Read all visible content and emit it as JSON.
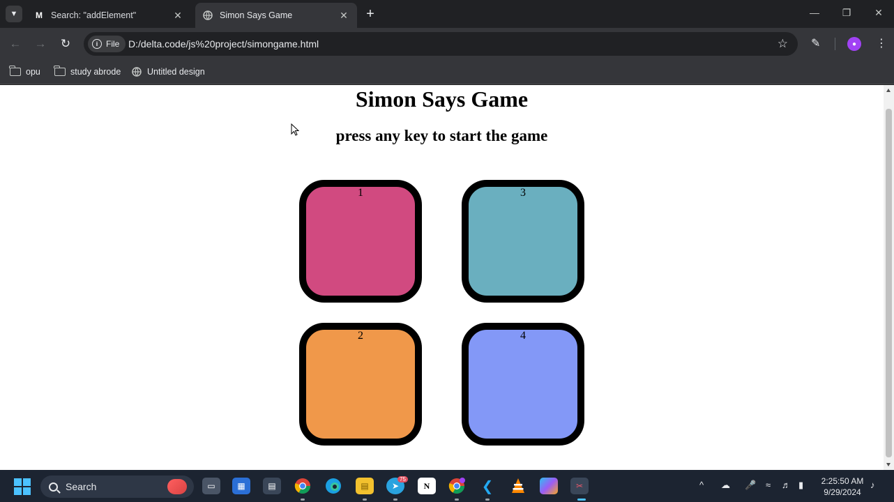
{
  "browser": {
    "tabs": [
      {
        "title": "Search: \"addElement\"",
        "favicon": "M",
        "active": false
      },
      {
        "title": "Simon Says Game",
        "favicon": "globe",
        "active": true
      }
    ],
    "url_scheme": "File",
    "url": "D:/delta.code/js%20project/simongame.html",
    "bookmarks": [
      {
        "label": "opu",
        "icon": "folder-icon"
      },
      {
        "label": "study abrode",
        "icon": "folder-icon"
      },
      {
        "label": "Untitled design",
        "icon": "globe-icon"
      }
    ]
  },
  "page": {
    "title": "Simon Says Game",
    "subtitle": "press any key to start the game",
    "buttons": [
      {
        "label": "1",
        "color": "#d14a80"
      },
      {
        "label": "3",
        "color": "#6aafbf"
      },
      {
        "label": "2",
        "color": "#f0984a"
      },
      {
        "label": "4",
        "color": "#8398f7"
      }
    ]
  },
  "taskbar": {
    "search_label": "Search",
    "telegram_badge": "75",
    "time": "2:25:50 AM",
    "date": "9/29/2024"
  },
  "colors": {
    "tabstrip": "#202124",
    "toolbar": "#35363a",
    "taskbar": "#1c2431"
  }
}
